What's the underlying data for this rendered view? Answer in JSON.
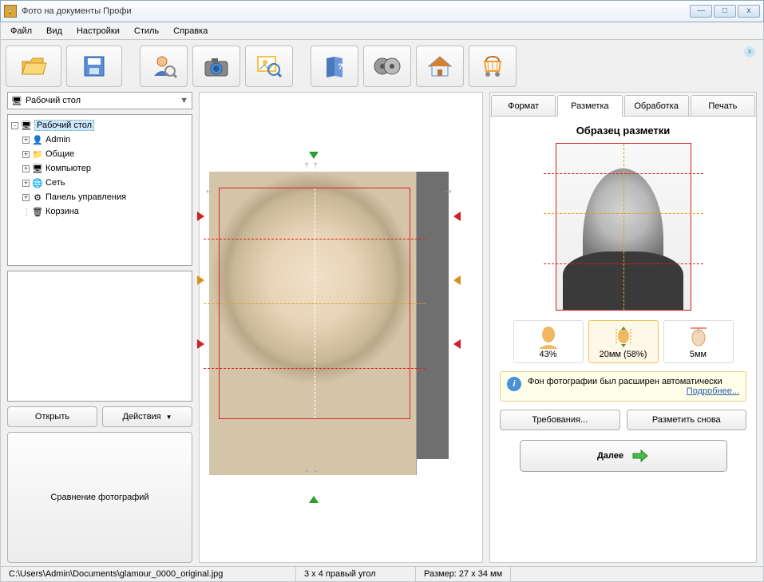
{
  "window": {
    "title": "Фото на документы Профи"
  },
  "menu": [
    "Файл",
    "Вид",
    "Настройки",
    "Стиль",
    "Справка"
  ],
  "sidebar": {
    "combo": "Рабочий стол",
    "tree": [
      {
        "label": "Рабочий стол",
        "icon": "🖥",
        "expanded": true,
        "selected": true,
        "level": 0
      },
      {
        "label": "Admin",
        "icon": "👤",
        "expandable": true,
        "level": 1
      },
      {
        "label": "Общие",
        "icon": "📁",
        "expandable": true,
        "level": 1
      },
      {
        "label": "Компьютер",
        "icon": "🖥",
        "expandable": true,
        "level": 1
      },
      {
        "label": "Сеть",
        "icon": "🌐",
        "expandable": true,
        "level": 1
      },
      {
        "label": "Панель управления",
        "icon": "⚙",
        "expandable": true,
        "level": 1
      },
      {
        "label": "Корзина",
        "icon": "🗑",
        "expandable": false,
        "level": 1
      }
    ],
    "open_btn": "Открыть",
    "actions_btn": "Действия",
    "compare_btn": "Сравнение фотографий"
  },
  "tabs": {
    "items": [
      "Формат",
      "Разметка",
      "Обработка",
      "Печать"
    ],
    "active": 1
  },
  "markup": {
    "title": "Образец разметки",
    "metrics": [
      {
        "label": "43%"
      },
      {
        "label": "20мм (58%)",
        "selected": true
      },
      {
        "label": "5мм"
      }
    ],
    "notice_text": "Фон фотографии был расширен автоматически",
    "notice_link": "Подробнее...",
    "requirements_btn": "Требования...",
    "remark_btn": "Разметить снова",
    "next_btn": "Далее"
  },
  "status": {
    "path": "C:\\Users\\Admin\\Documents\\glamour_0000_original.jpg",
    "format": "3 x 4 правый угол",
    "size": "Размер: 27 x 34 мм"
  }
}
